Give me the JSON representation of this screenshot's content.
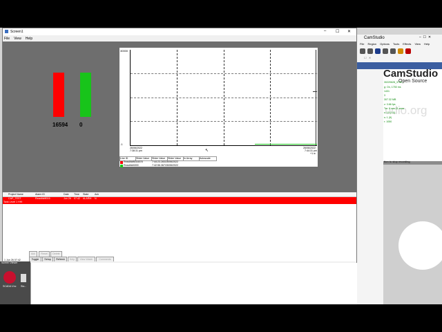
{
  "camstudio": {
    "title": "CamStudio",
    "menu": [
      "File",
      "Region",
      "Options",
      "Tools",
      "Effects",
      "View",
      "Help"
    ],
    "logo_main": "CamStudio",
    "logo_sub": "Open Source",
    "watermark": "udio.org",
    "stats": [
      "30220628_3742...",
      "g: On, 1750 ms",
      "1431",
      "3",
      "307.32 MB",
      "z: 3.66 fps",
      "Tm: 0 sec 21 secs",
      "s: 10 (1.0)",
      "s: 1 (9)",
      "r: 1050"
    ],
    "hint": "tton to stop recording"
  },
  "window": {
    "title": "Screen1",
    "minimize": "–",
    "maximize": "☐",
    "close": "✕",
    "menu": [
      "File",
      "View",
      "Help"
    ]
  },
  "bars": {
    "red_value": "16594",
    "green_value": "0",
    "red_color": "#ff0000",
    "green_color": "#18c41a"
  },
  "chart": {
    "y_max_label": "30000",
    "y_min_label": "-1",
    "x_left_date": "26/06/2022",
    "x_left_time": "7:38:31 pm",
    "x_right_date": "26/06/2022",
    "x_right_time": "7:44:31 pm",
    "x_right_extra": "+1 w",
    "columns": [
      "Line ID",
      "Slider Value",
      "Slider Value",
      "Slider Value",
      "In Array",
      "Autoscale"
    ],
    "rows": [
      {
        "name": "Read4t#8016578",
        "value": "7:44:23.283/26/06/2022",
        "color": "#ff0000"
      },
      {
        "name": "Read4t#4000",
        "value": "7:42:56.367/26/06/2022",
        "color": "#18c41a"
      }
    ]
  },
  "alarm": {
    "headers": [
      "Project Name",
      "Alarm ID",
      "Date",
      "Time",
      "State",
      "Ack"
    ],
    "row": {
      "project": "CAP_TEST",
      "alarm_id": "Read4t#8016",
      "date": "Jun 26",
      "time": "07:42",
      "state": "ALARM",
      "ack": "N",
      "description": "Tank Level 1 HHI"
    },
    "buttons_top": [
      "Ack",
      "Reset",
      "Delete"
    ],
    "buttons_bottom": [
      "Toggle",
      "Setup",
      "Refresh",
      "Help",
      "View Watch",
      "Comments"
    ],
    "status": "1 Jun 26 07:42"
  },
  "desktop": {
    "icon_label": "SCADA Vnc",
    "icon_label2": "Sla...",
    "corner_label": "Screen Viewer"
  }
}
